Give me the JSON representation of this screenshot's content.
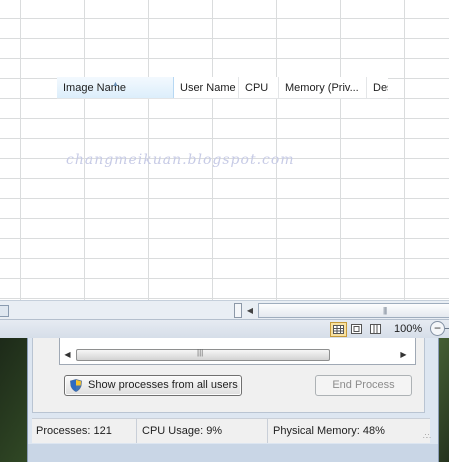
{
  "columns": {
    "image_name": "Image Name",
    "user_name": "User Name",
    "cpu": "CPU",
    "memory": "Memory (Priv...",
    "description": "Des"
  },
  "watermark": "changmeikuan.blogspot.com",
  "excel": {
    "zoom": "100%",
    "view_modes": [
      "normal",
      "page-layout",
      "page-break-preview"
    ],
    "active_view": "normal"
  },
  "task_manager": {
    "show_all_button": "Show processes from all users",
    "end_process_button": "End Process",
    "end_process_enabled": false,
    "status": {
      "processes": "Processes: 121",
      "cpu_usage": "CPU Usage: 9%",
      "physical_memory": "Physical Memory: 48%"
    }
  },
  "colors": {
    "selected_column_bg": "#dceefb",
    "watermark": "#c7cbe6",
    "active_view_button": "#f8e1a0"
  }
}
